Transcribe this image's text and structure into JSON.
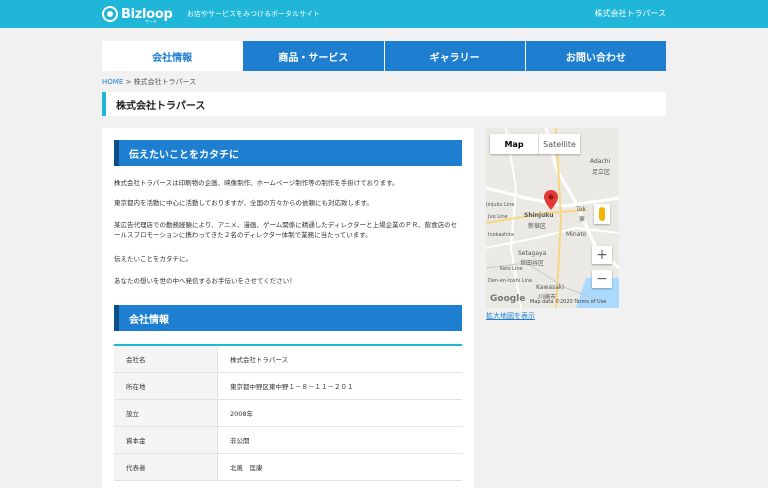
{
  "header": {
    "logo": "Bizloop",
    "logo_sub": "サーチ",
    "tagline": "お店やサービスをみつけるポータルサイト",
    "company": "株式会社トラパース"
  },
  "nav": [
    {
      "label": "会社情報",
      "active": true
    },
    {
      "label": "商品・サービス",
      "active": false
    },
    {
      "label": "ギャラリー",
      "active": false
    },
    {
      "label": "お問い合わせ",
      "active": false
    }
  ],
  "breadcrumb": {
    "home": "HOME",
    "sep": ">",
    "current": "株式会社トラパース"
  },
  "page_title": "株式会社トラパース",
  "intro": {
    "heading": "伝えたいことをカタチに",
    "paragraphs": [
      "株式会社トラパースは印刷物の企画、映像制作、ホームページ制作等の制作を手掛けております。",
      "東京都内を活動に中心に活動しておりますが、全国の方々からの依頼にも対応致します。",
      "某広告代理店での勤務経験により、アニメ、漫画、ゲーム関係に精通したディレクターと上場企業のＰＲ、飲食店のセールスプロモーションに携わってきた２名のディレクター体制で業務に当たっています。",
      "伝えたいことをカタチに。",
      "あなたの想いを世の中へ発信するお手伝いをさせてください！"
    ]
  },
  "company_info": {
    "heading": "会社情報",
    "rows": [
      {
        "label": "会社名",
        "value": "株式会社トラパース"
      },
      {
        "label": "所在地",
        "value": "東京都中野区東中野１－８－１１－２０１"
      },
      {
        "label": "設立",
        "value": "2008年"
      },
      {
        "label": "資本金",
        "value": "非公開"
      },
      {
        "label": "代表者",
        "value": "北風　匡康"
      }
    ]
  },
  "map": {
    "tab_map": "Map",
    "tab_satellite": "Satellite",
    "zoom_in": "+",
    "zoom_out": "−",
    "labels": [
      "Adachi",
      "足立区",
      "Shinjuku",
      "新宿区",
      "Setagaya",
      "世田谷区",
      "Minato",
      "Kawasaki",
      "川崎市",
      "Tok",
      "東",
      "Jinjuku Line",
      "Juo Line",
      "Inokashira",
      "Keio Line",
      "Den-en-toshi Line"
    ],
    "google": "Google",
    "attribution": "Map data ©2020   Terms of Use",
    "enlarge_link": "拡大地図を表示"
  },
  "colors": {
    "header": "#1fb6d8",
    "accent": "#1e7fd0",
    "pin": "#e53935"
  }
}
